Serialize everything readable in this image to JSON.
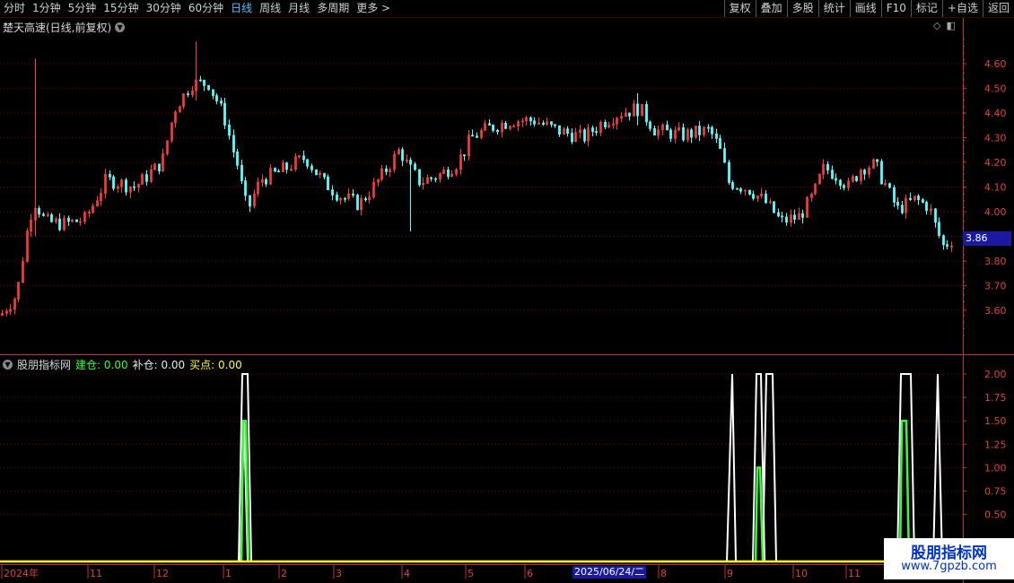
{
  "toolbar": {
    "periods": [
      "分时",
      "1分钟",
      "5分钟",
      "15分钟",
      "30分钟",
      "60分钟",
      "日线",
      "周线",
      "月线",
      "多周期",
      "更多 >"
    ],
    "active_index": 6,
    "right_buttons": [
      "复权",
      "叠加",
      "多股",
      "统计",
      "画线",
      "F10",
      "标记",
      "+自选",
      "返回"
    ]
  },
  "main_chart": {
    "title": "楚天高速(日线,前复权)",
    "price_ticks": [
      "4.60",
      "4.50",
      "4.40",
      "4.30",
      "4.20",
      "4.10",
      "4.00",
      "3.90",
      "3.80",
      "3.70",
      "3.60"
    ],
    "current_price": "3.86"
  },
  "indicator": {
    "name": "股朋指标网",
    "items": [
      {
        "label": "建仓:",
        "value": "0.00",
        "color": "#33ff33"
      },
      {
        "label": "补仓:",
        "value": "0.00",
        "color": "#e8e8e8"
      },
      {
        "label": "买点:",
        "value": "0.00",
        "color": "#ffff33"
      }
    ],
    "ticks": [
      "2.00",
      "1.75",
      "1.50",
      "1.25",
      "1.00",
      "0.75",
      "0.50"
    ]
  },
  "x_axis": {
    "labels": [
      "2024年",
      "11",
      "12",
      "1",
      "2",
      "3",
      "4",
      "5",
      "6",
      "2025/06/24/二",
      "8",
      "9",
      "10",
      "11"
    ],
    "cursor_date": "2025/06/24/二"
  },
  "colors": {
    "up": "#ff3c3c",
    "down": "#54ffff",
    "grid": "#7a0000",
    "axis": "#c03030",
    "ind_white": "#ffffff",
    "ind_green": "#33ff33",
    "ind_yellow": "#ffff00"
  },
  "watermark": {
    "title": "股朋指标网",
    "url": "www.7gpzb.com"
  }
}
